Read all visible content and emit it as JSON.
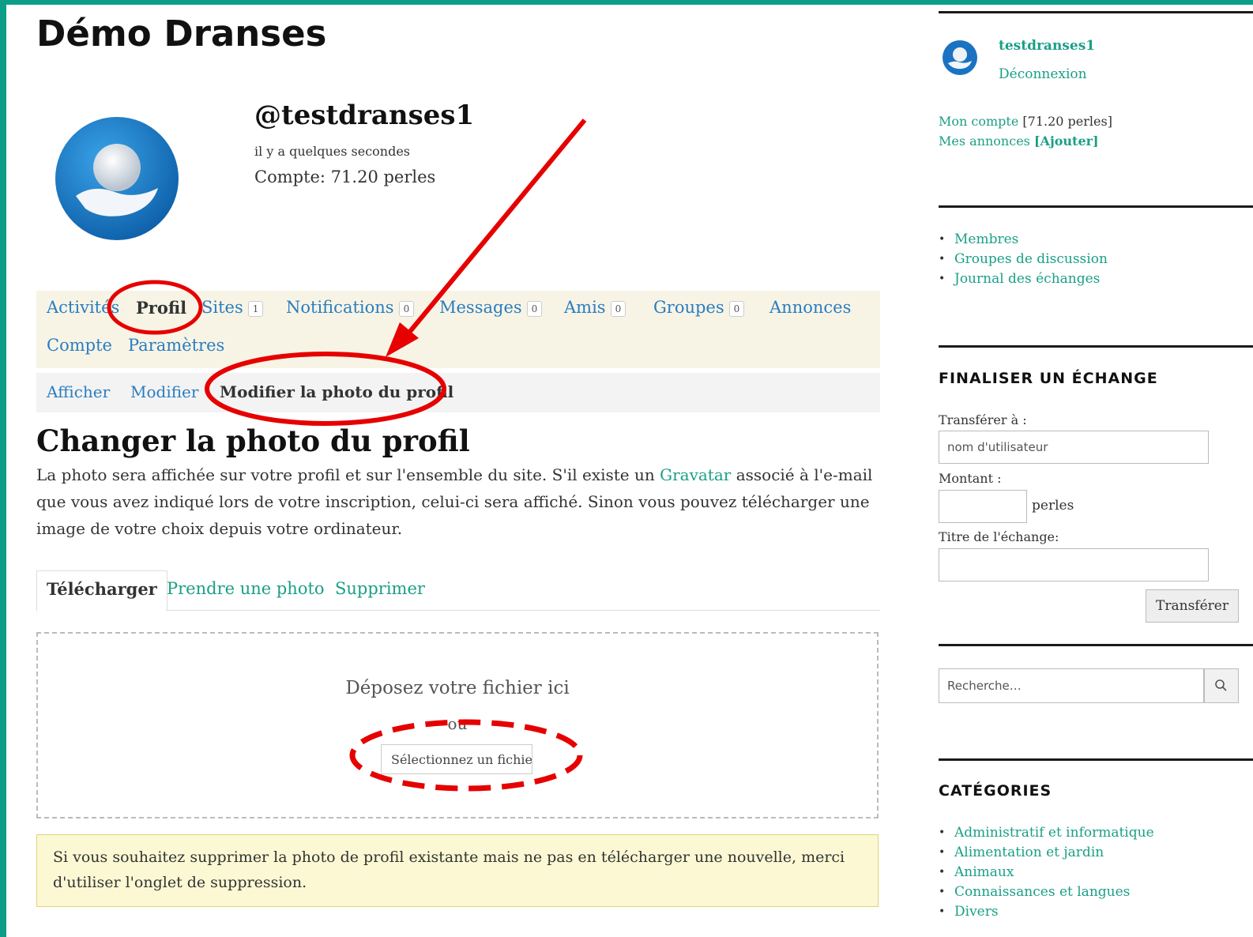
{
  "site": {
    "title": "Démo Dranses"
  },
  "profile": {
    "username": "@testdranses1",
    "last_active": "il y a quelques secondes",
    "account": "Compte: 71.20 perles"
  },
  "main_nav": [
    {
      "label": "Activités",
      "count": null
    },
    {
      "label": "Profil",
      "count": null
    },
    {
      "label": "Sites",
      "count": "1"
    },
    {
      "label": "Notifications",
      "count": "0"
    },
    {
      "label": "Messages",
      "count": "0"
    },
    {
      "label": "Amis",
      "count": "0"
    },
    {
      "label": "Groupes",
      "count": "0"
    },
    {
      "label": "Annonces",
      "count": null
    },
    {
      "label": "Compte",
      "count": null
    },
    {
      "label": "Paramètres",
      "count": null
    }
  ],
  "sub_nav": [
    "Afficher",
    "Modifier",
    "Modifier la photo du profil"
  ],
  "page": {
    "heading": "Changer la photo du profil",
    "intro_before": "La photo sera affichée sur votre profil et sur l'ensemble du site. S'il existe un ",
    "intro_link": "Gravatar",
    "intro_after": " associé à l'e-mail que vous avez indiqué lors de votre inscription, celui-ci sera affiché. Sinon vous pouvez télécharger une image de votre choix depuis votre ordinateur."
  },
  "tabs": [
    "Télécharger",
    "Prendre une photo",
    "Supprimer"
  ],
  "upload": {
    "drop_text": "Déposez votre fichier ici",
    "or_text": "ou",
    "file_button": "Sélectionnez un fichier"
  },
  "notice": "Si vous souhaitez supprimer la photo de profil existante mais ne pas en télécharger une nouvelle, merci d'utiliser l'onglet de suppression.",
  "sidebar": {
    "user": "testdranses1",
    "logout": "Déconnexion",
    "my_account_link": "Mon compte",
    "my_account_balance": "[71.20 perles]",
    "my_ads_link": "Mes annonces",
    "my_ads_add": "[Ajouter]",
    "links": [
      "Membres",
      "Groupes de discussion",
      "Journal des échanges"
    ],
    "exchange": {
      "title": "FINALISER UN ÉCHANGE",
      "to_label": "Transférer à :",
      "to_placeholder": "nom d'utilisateur",
      "amount_label": "Montant :",
      "amount_unit": "perles",
      "title_label": "Titre de l'échange:",
      "submit": "Transférer"
    },
    "search_placeholder": "Recherche…",
    "categories_title": "CATÉGORIES",
    "categories": [
      "Administratif et informatique",
      "Alimentation et jardin",
      "Animaux",
      "Connaissances et langues",
      "Divers"
    ]
  },
  "colors": {
    "frame": "#0d9e8a",
    "link": "#1a9f86",
    "nav_link": "#2b7dbf",
    "annotation": "#e60000"
  }
}
